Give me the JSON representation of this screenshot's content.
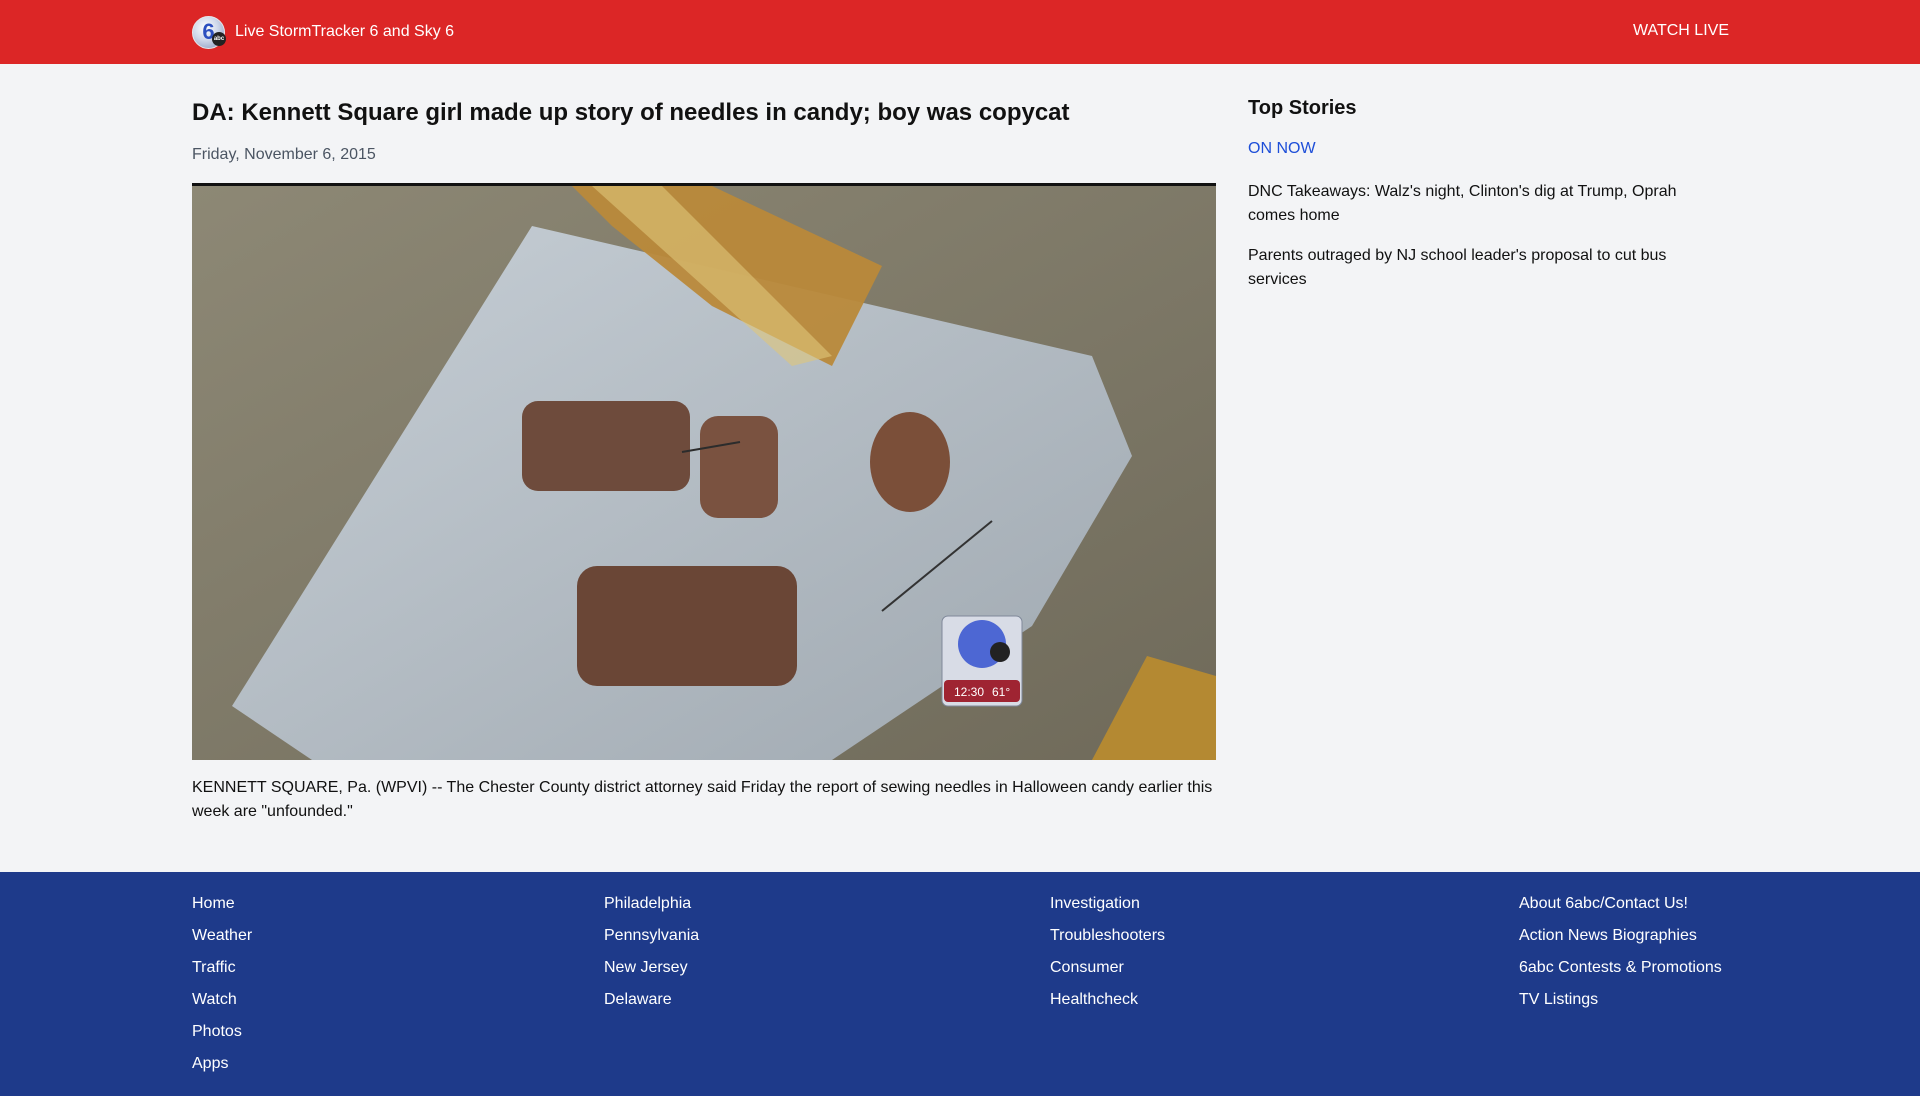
{
  "header": {
    "brand": "Live StormTracker 6 and Sky 6",
    "watch_live": "WATCH LIVE",
    "bg_color": "#dc2626"
  },
  "article": {
    "headline": "DA: Kennett Square girl made up story of needles in candy; boy was copycat",
    "date": "Friday, November 6, 2015",
    "image_bug": {
      "time": "12:30",
      "temp": "61°"
    },
    "body": "KENNETT SQUARE, Pa. (WPVI) -- The Chester County district attorney said Friday the report of sewing needles in Halloween candy earlier this week are \"unfounded.\""
  },
  "sidebar": {
    "title": "Top Stories",
    "on_now": "ON NOW",
    "stories": [
      "DNC Takeaways: Walz's night, Clinton's dig at Trump, Oprah comes home",
      "Parents outraged by NJ school leader's proposal to cut bus services"
    ]
  },
  "footer": {
    "bg_color": "#1e3a8a",
    "columns": [
      [
        "Home",
        "Weather",
        "Traffic",
        "Watch",
        "Photos",
        "Apps"
      ],
      [
        "Philadelphia",
        "Pennsylvania",
        "New Jersey",
        "Delaware"
      ],
      [
        "Investigation",
        "Troubleshooters",
        "Consumer",
        "Healthcheck"
      ],
      [
        "About 6abc/Contact Us!",
        "Action News Biographies",
        "6abc Contests & Promotions",
        "TV Listings"
      ]
    ]
  }
}
